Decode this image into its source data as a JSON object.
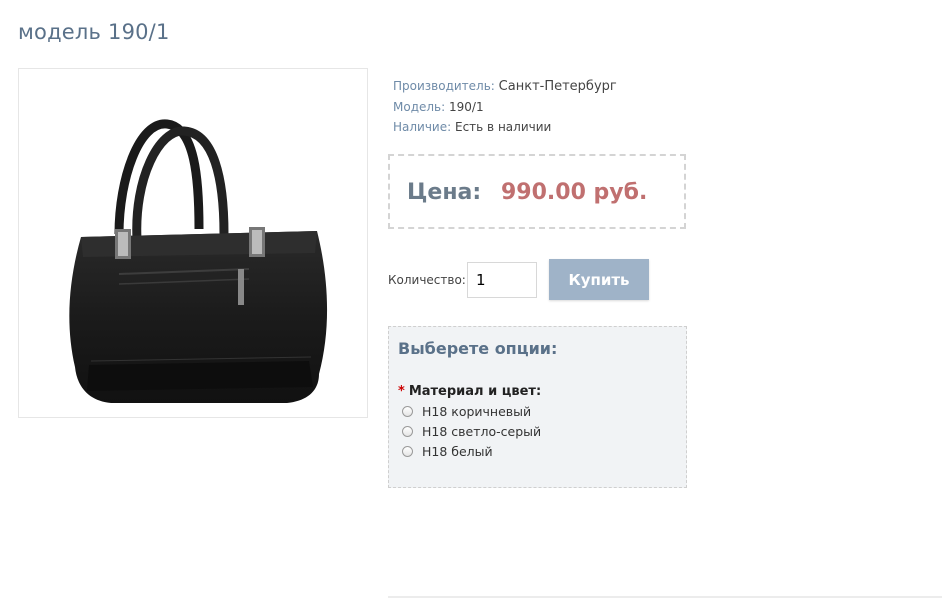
{
  "page": {
    "title": "модель 190/1"
  },
  "product_image": {
    "alt": "черная женская сумка"
  },
  "info": {
    "manufacturer_label": "Производитель:",
    "manufacturer_value": "Санкт-Петербург",
    "model_label": "Модель:",
    "model_value": "190/1",
    "availability_label": "Наличие:",
    "availability_value": "Есть в наличии"
  },
  "price": {
    "label": "Цена:",
    "value": "990.00 руб."
  },
  "purchase": {
    "quantity_label": "Количество:",
    "quantity_value": "1",
    "buy_label": "Купить"
  },
  "options": {
    "title": "Выберете опции:",
    "required_mark": "*",
    "group_label": "Материал и цвет:",
    "choices": [
      {
        "label": "Н18 коричневый"
      },
      {
        "label": "Н18 светло-серый"
      },
      {
        "label": "Н18 белый"
      }
    ]
  },
  "colors": {
    "title": "#5a7189",
    "price": "#c07070",
    "button": "#9fb3c8",
    "options_bg": "#f1f3f5"
  }
}
